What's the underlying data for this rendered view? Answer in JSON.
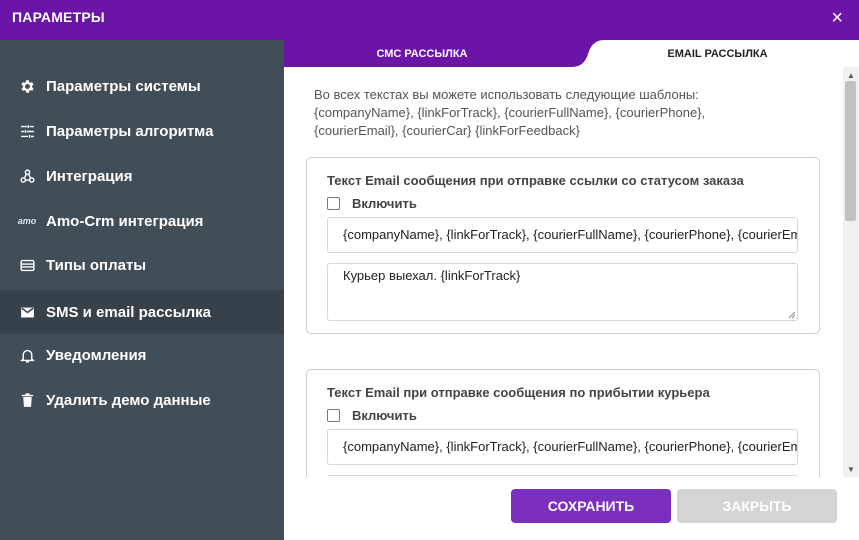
{
  "window": {
    "title": "ПАРАМЕТРЫ",
    "close_glyph": "×"
  },
  "colors": {
    "header": "#6a14a8",
    "sidebar": "#424e57",
    "sidebar_active": "#36414a",
    "save_button": "#7b2fbf",
    "close_button": "#d4d4d4"
  },
  "sidebar": {
    "items": [
      {
        "label": "Параметры системы",
        "icon": "gear-icon"
      },
      {
        "label": "Параметры алгоритма",
        "icon": "sliders-icon"
      },
      {
        "label": "Интеграция",
        "icon": "integration-icon"
      },
      {
        "label": "Amo-Crm интеграция",
        "icon": "amo-icon",
        "icon_text": "amo"
      },
      {
        "label": "Типы оплаты",
        "icon": "wallet-icon"
      },
      {
        "label": "SMS и email рассылка",
        "icon": "mail-icon",
        "active": true
      },
      {
        "label": "Уведомления",
        "icon": "bell-icon"
      },
      {
        "label": "Удалить демо данные",
        "icon": "trash-icon"
      }
    ]
  },
  "tabs": [
    {
      "label": "СМС РАССЫЛКА"
    },
    {
      "label": "EMAIL РАССЫЛКА",
      "active": true
    }
  ],
  "intro": {
    "line1": "Во всех текстах вы можете использовать следующие шаблоны:",
    "line2": "{companyName}, {linkForTrack}, {courierFullName}, {courierPhone},",
    "line3": "{courierEmail}, {courierCar} {linkForFeedback}"
  },
  "cards": [
    {
      "title": "Текст Email сообщения при отправке ссылки со статусом заказа",
      "checkbox_label": "Включить",
      "subject": "{companyName}, {linkForTrack}, {courierFullName}, {courierPhone}, {courierEmail}, {courierCar}",
      "body": "Курьер выехал. {linkForTrack}"
    },
    {
      "title": "Текст Email при отправке сообщения по прибытии курьера",
      "checkbox_label": "Включить",
      "subject": "{companyName}, {linkForTrack}, {courierFullName}, {courierPhone}, {courierEmail}, {courierCar}"
    }
  ],
  "footer": {
    "save_label": "СОХРАНИТЬ",
    "close_label": "ЗАКРЫТЬ"
  }
}
